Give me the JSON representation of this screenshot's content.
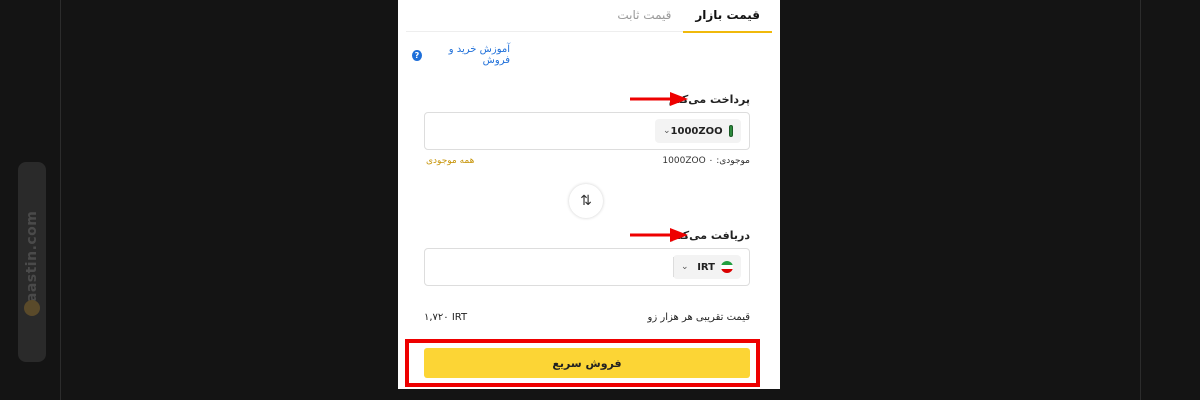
{
  "tabs": [
    {
      "label": "قیمت بازار",
      "active": true
    },
    {
      "label": "قیمت ثابت",
      "active": false
    }
  ],
  "help": {
    "text": "آموزش خرید و فروش",
    "icon": "question-circle-icon"
  },
  "pay": {
    "label": "پرداخت می‌کنم",
    "coin": "1000ZOO",
    "balance_text": "موجودی: 1000ZOO ۰",
    "all_balance": "همه موجودی"
  },
  "receive": {
    "label": "دریافت می‌کنم",
    "coin": "IRT"
  },
  "price": {
    "label": "قیمت تقریبی هر هزار زو",
    "value": "۱,۷۲۰ IRT"
  },
  "sell_button": "فروش سریع",
  "watermark": "Raastin.com",
  "colors": {
    "accent": "#fcd535",
    "link": "#1e6fd9",
    "annotation": "#e00000"
  }
}
